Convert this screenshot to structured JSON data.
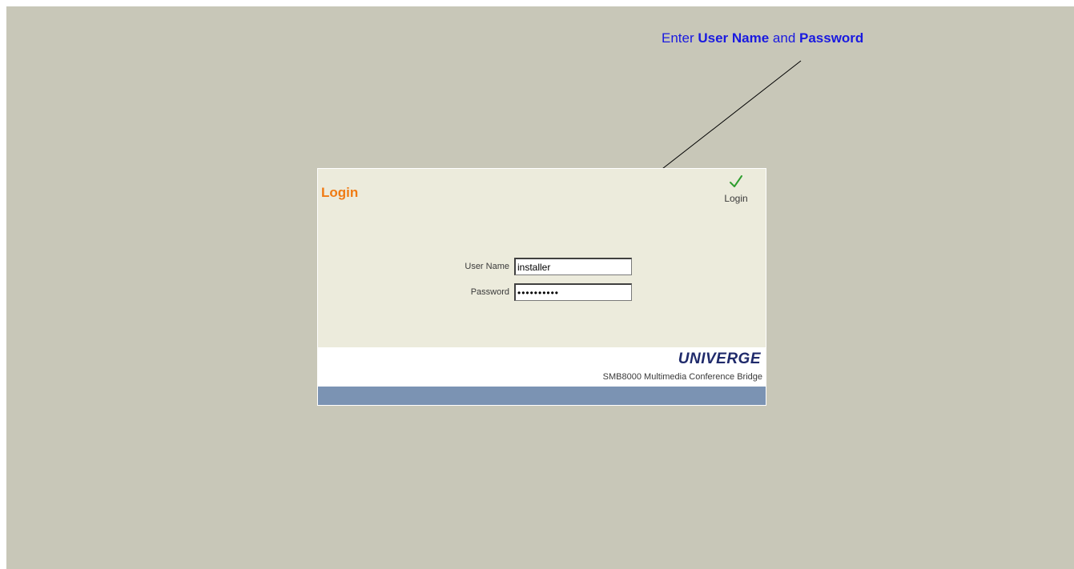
{
  "annotation": {
    "prefix": "Enter ",
    "user_name": "User Name",
    "middle": " and ",
    "password": "Password"
  },
  "login_panel": {
    "title": "Login",
    "action_label": "Login",
    "action_icon": "checkmark-icon",
    "fields": {
      "username_label": "User Name",
      "username_value": "installer",
      "password_label": "Password",
      "password_value": "••••••••••"
    },
    "brand": {
      "logo": "UNIVERGE",
      "product": "SMB8000 Multimedia Conference Bridge"
    }
  },
  "colors": {
    "background": "#c8c7b8",
    "panel": "#ecebdc",
    "title_orange": "#f07b14",
    "annotation_blue": "#1a1ae0",
    "check_green": "#2e9e2e",
    "footer_bar": "#7b93b3",
    "logo_navy": "#1f2a6b"
  }
}
